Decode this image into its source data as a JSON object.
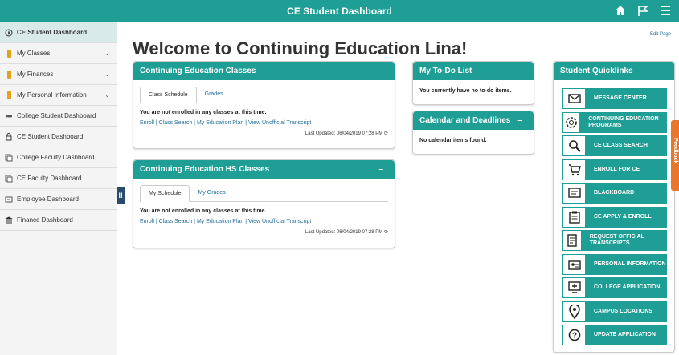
{
  "header": {
    "title": "CE Student Dashboard"
  },
  "sidebar": {
    "items": [
      {
        "label": "CE Student Dashboard",
        "icon": "compass-icon",
        "active": true
      },
      {
        "label": "My Classes",
        "icon": "folder-icon",
        "chevron": true
      },
      {
        "label": "My Finances",
        "icon": "folder-icon",
        "chevron": true
      },
      {
        "label": "My Personal Information",
        "icon": "folder-icon",
        "chevron": true
      },
      {
        "label": "College Student Dashboard",
        "icon": "students-icon"
      },
      {
        "label": "CE Student Dashboard",
        "icon": "lock-icon"
      },
      {
        "label": "College Faculty Dashboard",
        "icon": "faculty-icon"
      },
      {
        "label": "CE Faculty Dashboard",
        "icon": "faculty-icon"
      },
      {
        "label": "Employee Dashboard",
        "icon": "employee-icon"
      },
      {
        "label": "Finance Dashboard",
        "icon": "bank-icon"
      }
    ],
    "collapse_label": "II"
  },
  "main": {
    "welcome": "Welcome to Continuing Education Lina!",
    "edit_page": "Edit Page"
  },
  "ce_classes": {
    "title": "Continuing Education Classes",
    "min": "–",
    "tabs": [
      "Class Schedule",
      "Grades"
    ],
    "message": "You are not enrolled in any classes at this time.",
    "links": "Enroll | Class Search | My Education Plan | View Unofficial Transcript",
    "updated": "Last Updated: 06/04/2019 07:28 PM"
  },
  "hs_classes": {
    "title": "Continuing Education HS Classes",
    "min": "–",
    "tabs": [
      "My Schedule",
      "My Grades"
    ],
    "message": "You are not enrolled in any classes at this time.",
    "links": "Enroll | Class Search | My Education Plan | View Unofficial Transcript",
    "updated": "Last Updated: 06/04/2019 07:28 PM"
  },
  "todo": {
    "title": "My To-Do List",
    "min": "–",
    "message": "You currently have no to-do items."
  },
  "calendar": {
    "title": "Calendar and Deadlines",
    "min": "–",
    "message": "No calendar items found."
  },
  "quicklinks": {
    "title": "Student Quicklinks",
    "min": "–",
    "items": [
      {
        "label": "MESSAGE CENTER",
        "icon": "envelope-icon"
      },
      {
        "label": "CONTINUING EDUCATION PROGRAMS",
        "icon": "gear-icon"
      },
      {
        "label": "CE CLASS SEARCH",
        "icon": "magnifier-icon"
      },
      {
        "label": "ENROLL FOR CE",
        "icon": "cart-icon"
      },
      {
        "label": "BLACKBOARD",
        "icon": "blackboard-icon"
      },
      {
        "label": "CE APPLY & ENROLL",
        "icon": "clipboard-icon"
      },
      {
        "label": "REQUEST OFFICIAL TRANSCRIPTS",
        "icon": "transcript-icon"
      },
      {
        "label": "PERSONAL INFORMATION",
        "icon": "id-card-icon"
      },
      {
        "label": "COLLEGE APPLICATION",
        "icon": "monitor-icon"
      },
      {
        "label": "CAMPUS LOCATIONS",
        "icon": "map-pin-icon"
      },
      {
        "label": "UPDATE APPLICATION",
        "icon": "question-icon"
      }
    ]
  },
  "feedback": {
    "label": "Feedback"
  }
}
